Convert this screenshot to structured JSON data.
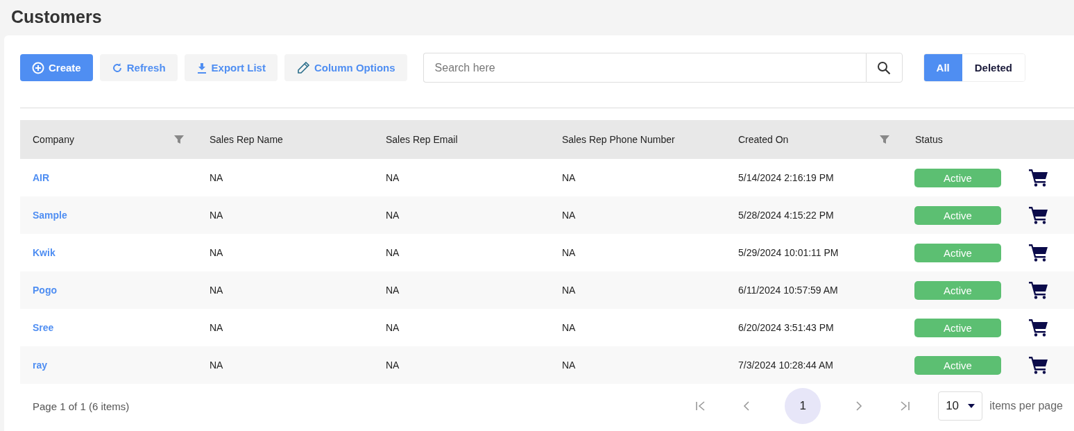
{
  "page": {
    "title": "Customers"
  },
  "toolbar": {
    "buttons": [
      {
        "kind": "create",
        "label": "Create"
      },
      {
        "kind": "refresh",
        "label": "Refresh"
      },
      {
        "kind": "export",
        "label": "Export List"
      },
      {
        "kind": "columns",
        "label": "Column Options"
      }
    ]
  },
  "search": {
    "placeholder": "Search here"
  },
  "filter_tabs": [
    {
      "label": "All",
      "selected": true
    },
    {
      "label": "Deleted",
      "selected": false
    }
  ],
  "table": {
    "columns": [
      {
        "label": "Company",
        "filterable": true
      },
      {
        "label": "Sales Rep Name",
        "filterable": false
      },
      {
        "label": "Sales Rep Email",
        "filterable": false
      },
      {
        "label": "Sales Rep Phone Number",
        "filterable": false
      },
      {
        "label": "Created On",
        "filterable": true
      },
      {
        "label": "Status",
        "filterable": false
      }
    ],
    "rows": [
      {
        "company": "AIR",
        "rep_name": "NA",
        "rep_email": "NA",
        "rep_phone": "NA",
        "created_on": "5/14/2024 2:16:19 PM",
        "status": "Active"
      },
      {
        "company": "Sample",
        "rep_name": "NA",
        "rep_email": "NA",
        "rep_phone": "NA",
        "created_on": "5/28/2024 4:15:22 PM",
        "status": "Active"
      },
      {
        "company": "Kwik",
        "rep_name": "NA",
        "rep_email": "NA",
        "rep_phone": "NA",
        "created_on": "5/29/2024 10:01:11 PM",
        "status": "Active"
      },
      {
        "company": "Pogo",
        "rep_name": "NA",
        "rep_email": "NA",
        "rep_phone": "NA",
        "created_on": "6/11/2024 10:57:59 AM",
        "status": "Active"
      },
      {
        "company": "Sree",
        "rep_name": "NA",
        "rep_email": "NA",
        "rep_phone": "NA",
        "created_on": "6/20/2024 3:51:43 PM",
        "status": "Active"
      },
      {
        "company": "ray",
        "rep_name": "NA",
        "rep_email": "NA",
        "rep_phone": "NA",
        "created_on": "7/3/2024 10:28:44 AM",
        "status": "Active"
      }
    ]
  },
  "pager": {
    "info": "Page 1 of 1 (6 items)",
    "pages": [
      {
        "label": "1",
        "selected": true
      }
    ],
    "page_size": "10",
    "page_size_label": "items per page"
  }
}
